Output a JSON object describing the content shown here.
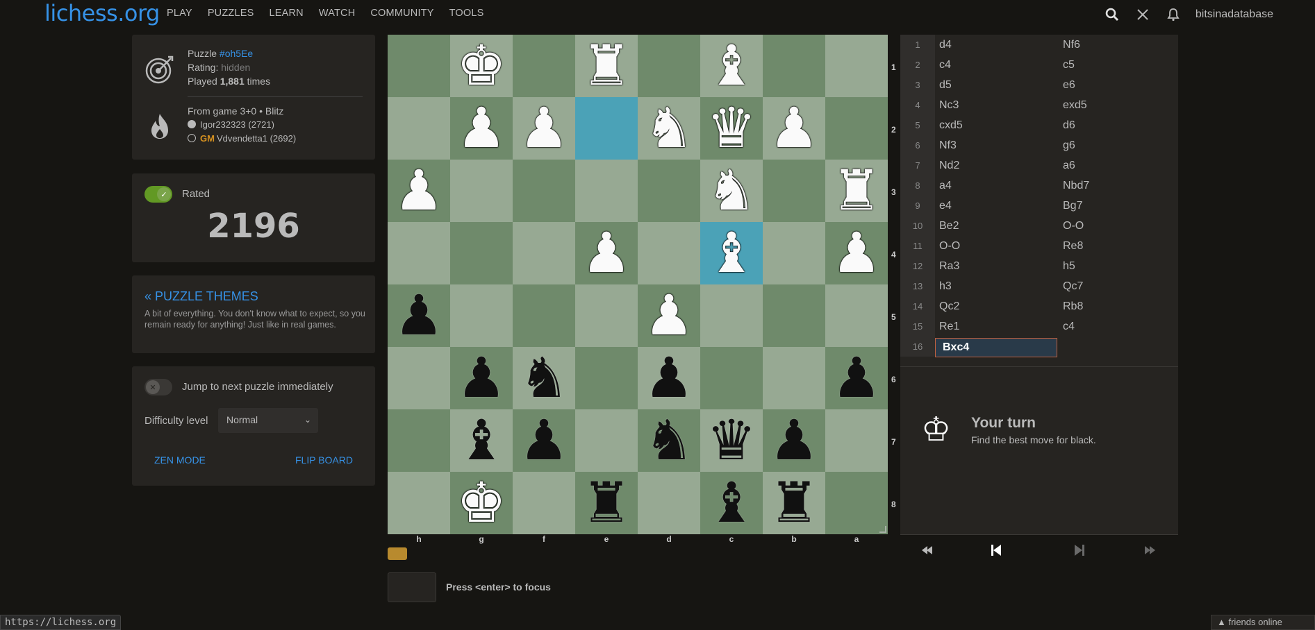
{
  "header": {
    "logo": "lichess.org",
    "nav": [
      "PLAY",
      "PUZZLES",
      "LEARN",
      "WATCH",
      "COMMUNITY",
      "TOOLS"
    ],
    "username": "bitsinadatabase"
  },
  "puzzle_info": {
    "puzzle_prefix": "Puzzle",
    "puzzle_id": "#oh5Ee",
    "rating_label": "Rating:",
    "rating_value": "hidden",
    "played_prefix": "Played",
    "played_count": "1,881",
    "played_suffix": "times",
    "game_line": "From game 3+0 • Blitz",
    "white_player": "Igor232323 (2721)",
    "black_title": "GM",
    "black_player": "Vdvendetta1 (2692)"
  },
  "rating_panel": {
    "label": "Rated",
    "value": "2196"
  },
  "themes": {
    "title": "« PUZZLE THEMES",
    "description": "A bit of everything. You don't know what to expect, so you remain ready for anything! Just like in real games."
  },
  "settings": {
    "jump_label": "Jump to next puzzle immediately",
    "difficulty_label": "Difficulty level",
    "difficulty_value": "Normal",
    "zen_mode": "ZEN MODE",
    "flip_board": "FLIP BOARD"
  },
  "board": {
    "orientation": "black",
    "ranks": [
      "1",
      "2",
      "3",
      "4",
      "5",
      "6",
      "7",
      "8"
    ],
    "files": [
      "h",
      "g",
      "f",
      "e",
      "d",
      "c",
      "b",
      "a"
    ],
    "highlight_squares": [
      "e2",
      "c4"
    ],
    "pieces": [
      {
        "square": "g1",
        "piece": "K",
        "color": "white"
      },
      {
        "square": "e1",
        "piece": "R",
        "color": "white"
      },
      {
        "square": "c1",
        "piece": "B",
        "color": "white"
      },
      {
        "square": "g2",
        "piece": "P",
        "color": "white"
      },
      {
        "square": "f2",
        "piece": "P",
        "color": "white"
      },
      {
        "square": "d2",
        "piece": "N",
        "color": "white"
      },
      {
        "square": "c2",
        "piece": "Q",
        "color": "white"
      },
      {
        "square": "b2",
        "piece": "P",
        "color": "white"
      },
      {
        "square": "h3",
        "piece": "P",
        "color": "white"
      },
      {
        "square": "c3",
        "piece": "N",
        "color": "white"
      },
      {
        "square": "a3",
        "piece": "R",
        "color": "white"
      },
      {
        "square": "e4",
        "piece": "P",
        "color": "white"
      },
      {
        "square": "c4",
        "piece": "B",
        "color": "white"
      },
      {
        "square": "a4",
        "piece": "P",
        "color": "white"
      },
      {
        "square": "d5",
        "piece": "P",
        "color": "white"
      },
      {
        "square": "h5",
        "piece": "P",
        "color": "black"
      },
      {
        "square": "g6",
        "piece": "P",
        "color": "black"
      },
      {
        "square": "f6",
        "piece": "N",
        "color": "black"
      },
      {
        "square": "d6",
        "piece": "P",
        "color": "black"
      },
      {
        "square": "a6",
        "piece": "P",
        "color": "black"
      },
      {
        "square": "g7",
        "piece": "B",
        "color": "black"
      },
      {
        "square": "f7",
        "piece": "P",
        "color": "black"
      },
      {
        "square": "d7",
        "piece": "N",
        "color": "black"
      },
      {
        "square": "c7",
        "piece": "Q",
        "color": "black"
      },
      {
        "square": "b7",
        "piece": "P",
        "color": "black"
      },
      {
        "square": "g8",
        "piece": "K",
        "color": "white-outline"
      },
      {
        "square": "e8",
        "piece": "R",
        "color": "black"
      },
      {
        "square": "c8",
        "piece": "B",
        "color": "black"
      },
      {
        "square": "b8",
        "piece": "R",
        "color": "black"
      }
    ]
  },
  "moves": [
    {
      "n": "1",
      "w": "d4",
      "b": "Nf6"
    },
    {
      "n": "2",
      "w": "c4",
      "b": "c5"
    },
    {
      "n": "3",
      "w": "d5",
      "b": "e6"
    },
    {
      "n": "4",
      "w": "Nc3",
      "b": "exd5"
    },
    {
      "n": "5",
      "w": "cxd5",
      "b": "d6"
    },
    {
      "n": "6",
      "w": "Nf3",
      "b": "g6"
    },
    {
      "n": "7",
      "w": "Nd2",
      "b": "a6"
    },
    {
      "n": "8",
      "w": "a4",
      "b": "Nbd7"
    },
    {
      "n": "9",
      "w": "e4",
      "b": "Bg7"
    },
    {
      "n": "10",
      "w": "Be2",
      "b": "O-O"
    },
    {
      "n": "11",
      "w": "O-O",
      "b": "Re8"
    },
    {
      "n": "12",
      "w": "Ra3",
      "b": "h5"
    },
    {
      "n": "13",
      "w": "h3",
      "b": "Qc7"
    },
    {
      "n": "14",
      "w": "Qc2",
      "b": "Rb8"
    },
    {
      "n": "15",
      "w": "Re1",
      "b": "c4"
    },
    {
      "n": "16",
      "w": "Bxc4",
      "b": ""
    }
  ],
  "turn": {
    "title": "Your turn",
    "subtitle": "Find the best move for black."
  },
  "keyboard_hint": "Press <enter> to focus",
  "status_url": "https://lichess.org",
  "friends": "friends online",
  "colors": {
    "accent": "#3692e7",
    "background": "#161512",
    "panel": "#262421",
    "highlight": "#4ba2b7",
    "gm": "#d59120"
  }
}
